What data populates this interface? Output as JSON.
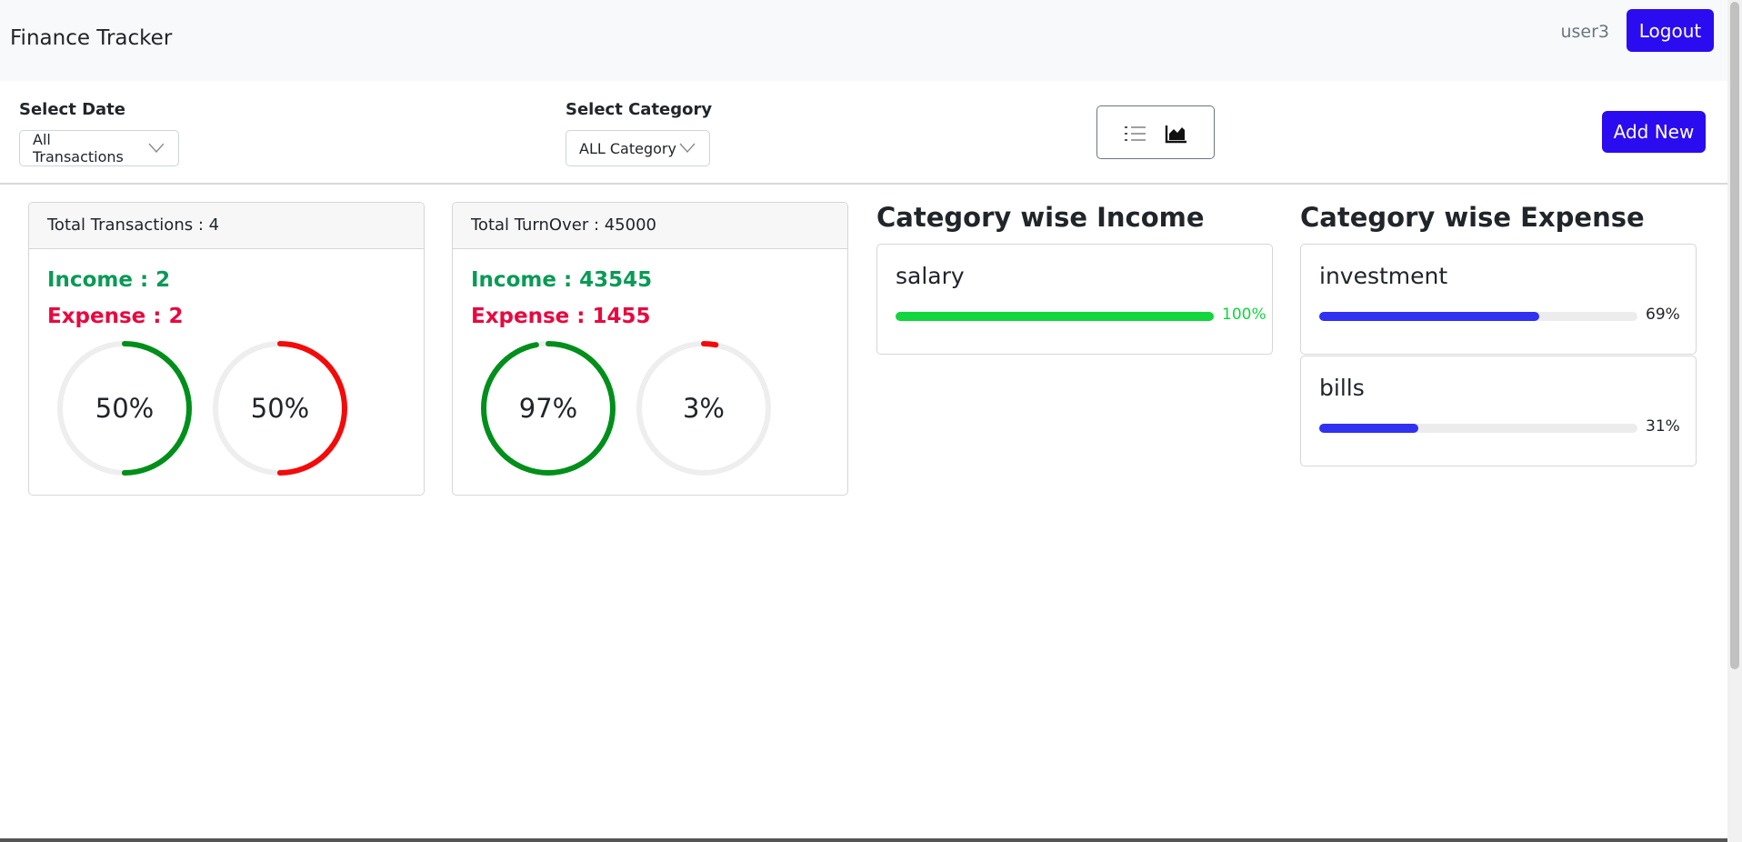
{
  "navbar": {
    "brand": "Finance Tracker",
    "username": "user3",
    "logout_label": "Logout"
  },
  "filters": {
    "date_label": "Select Date",
    "date_value": "All Transactions",
    "category_label": "Select Category",
    "category_value": "ALL Category",
    "view_icons": [
      "list-icon",
      "area-chart-icon"
    ],
    "add_label": "Add New"
  },
  "transactions_card": {
    "header": "Total Transactions : 4",
    "income": "Income : 2",
    "expense": "Expense : 2",
    "income_percent": 50,
    "expense_percent": 50,
    "income_label": "50%",
    "expense_label": "50%"
  },
  "turnover_card": {
    "header": "Total TurnOver : 45000",
    "income": "Income : 43545",
    "expense": "Expense : 1455",
    "income_percent": 97,
    "expense_percent": 3,
    "income_label": "97%",
    "expense_label": "3%"
  },
  "income_categories": {
    "title": "Category wise Income",
    "items": [
      {
        "name": "salary",
        "percent": 100,
        "label": "100%"
      }
    ]
  },
  "expense_categories": {
    "title": "Category wise Expense",
    "items": [
      {
        "name": "investment",
        "percent": 69,
        "label": "69%"
      },
      {
        "name": "bills",
        "percent": 31,
        "label": "31%"
      }
    ]
  },
  "colors": {
    "primary": "#2b0bf0",
    "income_text": "#0a9a56",
    "expense_text": "#e8083f",
    "income_ring": "#008f1a",
    "expense_ring": "#f50a0a",
    "income_bar": "#11d63d",
    "expense_bar": "#3131f2"
  }
}
